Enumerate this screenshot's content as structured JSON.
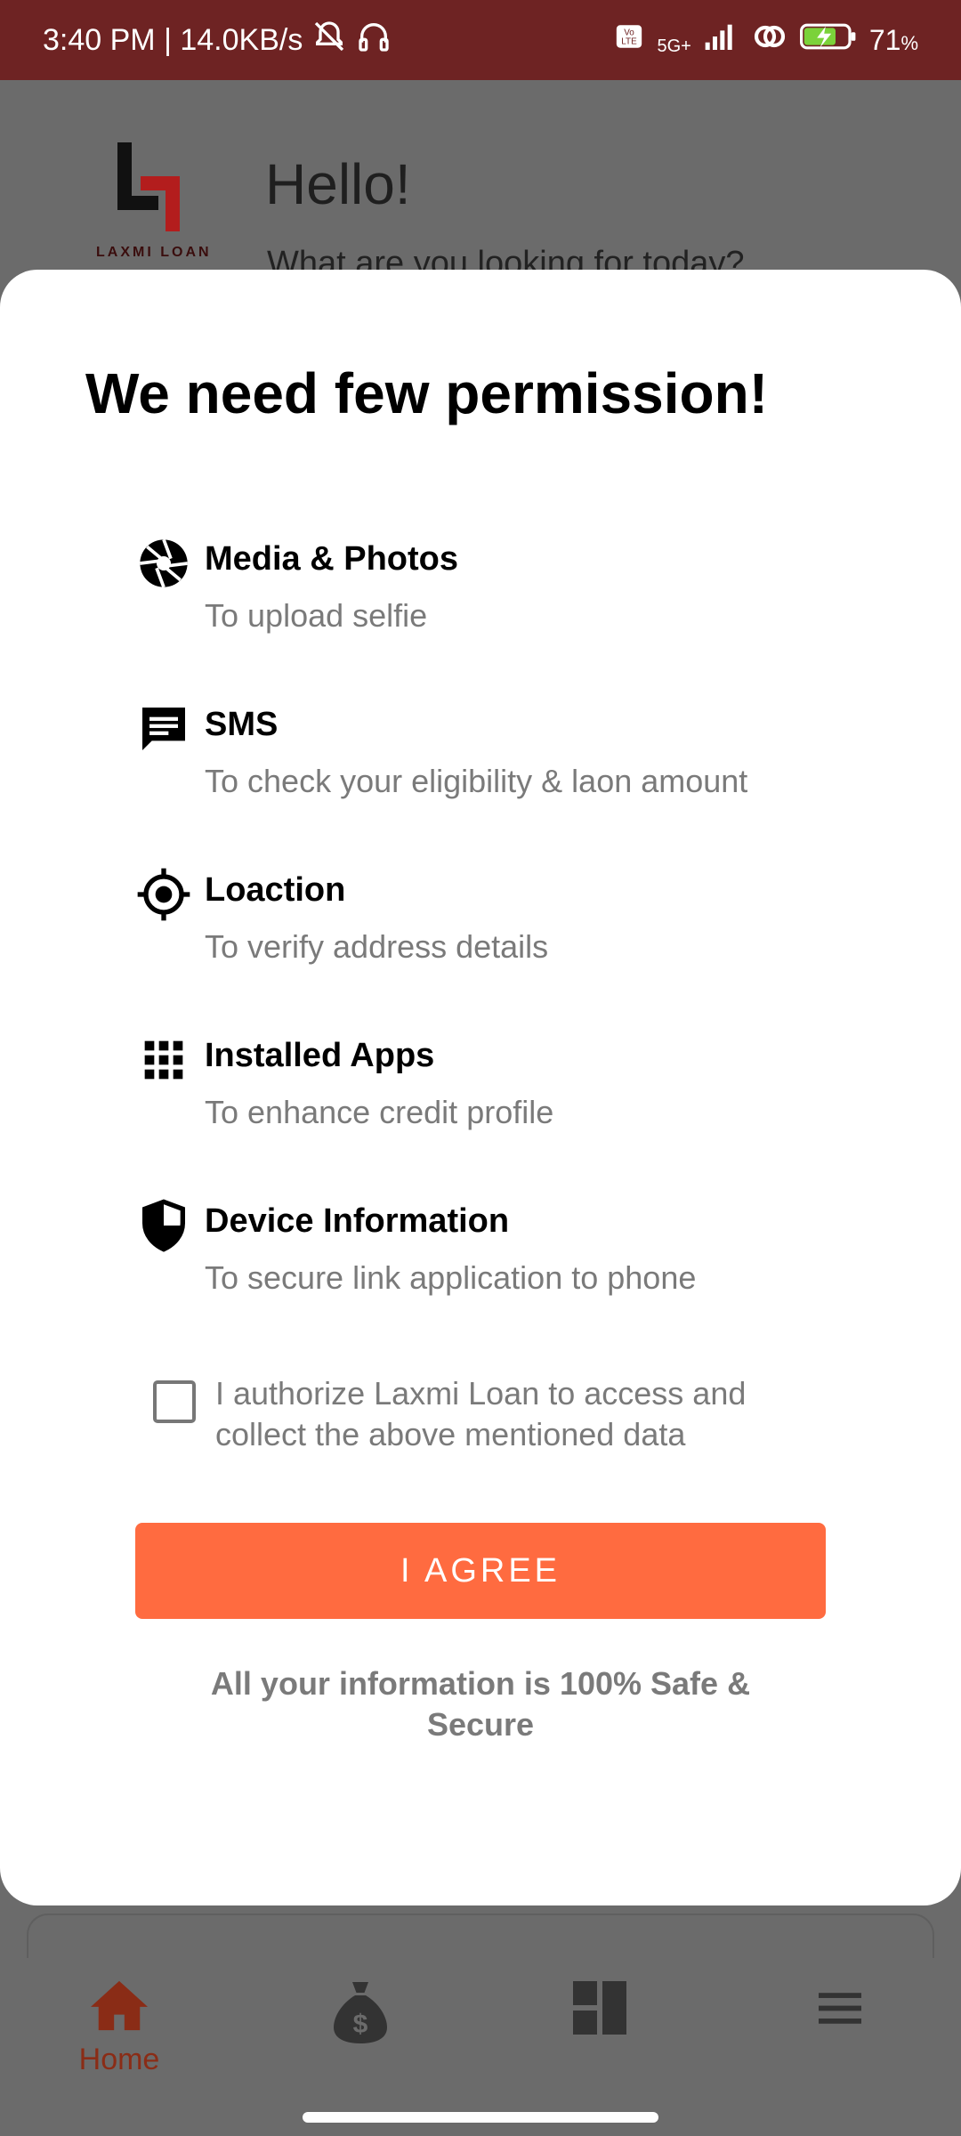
{
  "status_bar": {
    "time_speed": "3:40 PM | 14.0KB/s",
    "network": "5G+",
    "battery": "71",
    "battery_unit": "%",
    "icons": [
      "mute-bell-icon",
      "headphones-icon",
      "volte-icon",
      "signal-icon",
      "hotspot-icon",
      "battery-charging-icon"
    ]
  },
  "app": {
    "logo_text": "LAXMI LOAN",
    "greeting": "Hello!",
    "subtitle": "What are you looking for today?"
  },
  "sheet": {
    "title": "We need few permission!",
    "permissions": [
      {
        "icon": "aperture-icon",
        "title": "Media & Photos",
        "desc": "To upload selfie"
      },
      {
        "icon": "sms-icon",
        "title": "SMS",
        "desc": "To check your eligibility & laon amount"
      },
      {
        "icon": "location-target-icon",
        "title": "Loaction",
        "desc": "To verify address details"
      },
      {
        "icon": "apps-grid-icon",
        "title": "Installed Apps",
        "desc": "To enhance credit profile"
      },
      {
        "icon": "shield-icon",
        "title": "Device Information",
        "desc": "To secure link application to phone"
      }
    ],
    "consent_text": "I authorize Laxmi Loan to access and collect the above mentioned data",
    "consent_checked": false,
    "agree_label": "I AGREE",
    "safe_text": "All your information is 100% Safe & Secure"
  },
  "bottom_nav": {
    "items": [
      {
        "icon": "home-icon",
        "label": "Home",
        "active": true
      },
      {
        "icon": "money-bag-icon",
        "label": ""
      },
      {
        "icon": "dashboard-icon",
        "label": ""
      },
      {
        "icon": "menu-icon",
        "label": ""
      }
    ]
  },
  "colors": {
    "status_bar": "#6e2323",
    "accent": "#ff6b40",
    "active_nav": "#8a2c16",
    "scrim": "#6b6b6b"
  }
}
